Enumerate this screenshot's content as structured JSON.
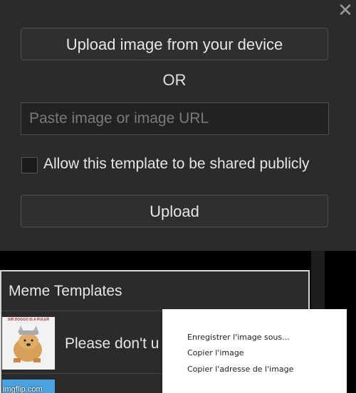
{
  "modal": {
    "close_glyph": "✕",
    "upload_device_label": "Upload image from your device",
    "or_label": "OR",
    "url_placeholder": "Paste image or image URL",
    "share_checkbox_label": "Allow this template to be shared publicly",
    "upload_label": "Upload"
  },
  "templates": {
    "title": "Meme Templates",
    "items": [
      {
        "title": "Please don't u",
        "thumb_caption": "SIR DOGGO IS A RULER"
      }
    ],
    "watermark": "imgflip.com"
  },
  "context_menu": {
    "items": [
      "Enregistrer l'image sous...",
      "Copier l'image",
      "Copier l'adresse de l'image"
    ]
  },
  "colors": {
    "modal_bg": "#2b2b2b",
    "page_bg": "#000000",
    "panel_border": "#d6d6d6",
    "menu_bg": "#ffffff"
  }
}
